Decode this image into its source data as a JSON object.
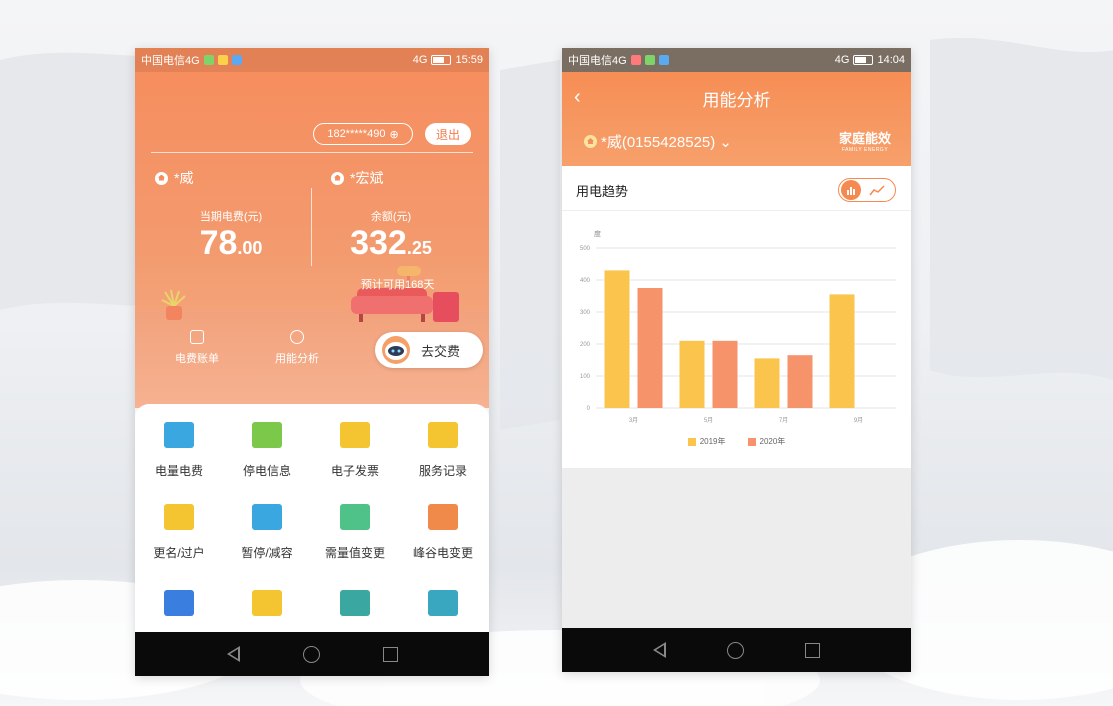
{
  "phone1": {
    "status": {
      "carrier": "中国电信4G",
      "signal": "4G",
      "time": "15:59"
    },
    "account_pill": "182*****490",
    "logout_label": "退出",
    "accounts": [
      {
        "name": "*威",
        "stat_label": "当期电费(元)",
        "value_int": "78",
        "value_dec": ".00"
      },
      {
        "name": "*宏斌",
        "stat_label": "余额(元)",
        "value_int": "332",
        "value_dec": ".25"
      }
    ],
    "prediction": "预计可用168天",
    "quick_actions": [
      {
        "label": "电费账单"
      },
      {
        "label": "用能分析"
      }
    ],
    "pay_button": "去交费",
    "services": [
      {
        "label": "电量电费",
        "icon": "monitor-bolt-icon",
        "color": "#3aa7e0"
      },
      {
        "label": "停电信息",
        "icon": "power-off-info-icon",
        "color": "#7cc84b"
      },
      {
        "label": "电子发票",
        "icon": "invoice-icon",
        "color": "#f5c531"
      },
      {
        "label": "服务记录",
        "icon": "notepad-icon",
        "color": "#f5c531"
      },
      {
        "label": "更名/过户",
        "icon": "users-icon",
        "color": "#f5c531"
      },
      {
        "label": "暂停/减容",
        "icon": "pause-meter-icon",
        "color": "#3aa7e0"
      },
      {
        "label": "需量值变更",
        "icon": "demand-icon",
        "color": "#4fc28a"
      },
      {
        "label": "峰谷电变更",
        "icon": "peak-valley-icon",
        "color": "#f08a4b"
      },
      {
        "label": "",
        "icon": "board-icon",
        "color": "#3a7fe0"
      },
      {
        "label": "",
        "icon": "search-doc-icon",
        "color": "#f5c531"
      },
      {
        "label": "",
        "icon": "meter-icon",
        "color": "#3aa7a0"
      },
      {
        "label": "",
        "icon": "card-icon",
        "color": "#3aa7c0"
      }
    ]
  },
  "phone2": {
    "status": {
      "carrier": "中国电信4G",
      "signal": "4G",
      "time": "14:04"
    },
    "title": "用能分析",
    "account": "*威(0155428525)",
    "brand": {
      "cn": "家庭能效",
      "en": "FAMILY ENERGY"
    },
    "section_title": "用电趋势"
  },
  "chart_data": {
    "type": "bar",
    "ylabel": "度",
    "ylim": [
      0,
      500
    ],
    "yticks": [
      "0",
      "100",
      "200",
      "300",
      "400",
      "500"
    ],
    "categories": [
      "3月",
      "5月",
      "7月",
      "9月"
    ],
    "series": [
      {
        "name": "2019年",
        "color": "#fbc44d",
        "values": [
          430,
          210,
          155,
          355
        ]
      },
      {
        "name": "2020年",
        "color": "#f6936a",
        "values": [
          375,
          210,
          165,
          null
        ]
      }
    ]
  }
}
